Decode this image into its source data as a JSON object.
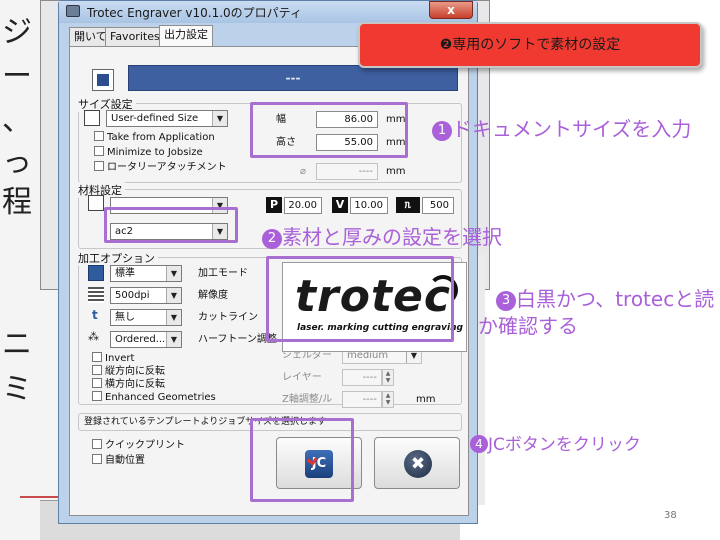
{
  "window": {
    "title": "Trotec Engraver v10.1.0のプロパティ",
    "close_label": "x"
  },
  "tabs": [
    {
      "label": "開いて"
    },
    {
      "label": "Favorites"
    },
    {
      "label": "出力設定"
    }
  ],
  "job_bar": {
    "text": "---"
  },
  "size_settings": {
    "group_label": "サイズ設定",
    "preset_value": "User-defined Size",
    "take_from_app": "Take from Application",
    "minimize": "Minimize to Jobsize",
    "rotary": "ロータリーアタッチメント",
    "width_label": "幅",
    "width_value": "86.00",
    "height_label": "高さ",
    "height_value": "55.00",
    "unit": "mm",
    "diameter_symbol": "⌀",
    "diameter_value": "----",
    "diameter_unit": "mm"
  },
  "material_settings": {
    "group_label": "材料設定",
    "material_value": "ac2",
    "power_badge": "P",
    "power_value": "20.00",
    "velocity_badge": "V",
    "velocity_value": "10.00",
    "ppi_value": "500"
  },
  "process_options": {
    "group_label": "加工オプション",
    "mode_value": "標準",
    "mode_label": "加工モード",
    "resolution_value": "500dpi",
    "resolution_label": "解像度",
    "cutline_value": "無し",
    "cutline_label": "カットライン",
    "halftone_value": "Ordered...",
    "halftone_label": "ハーフトーン調整",
    "invert": "Invert",
    "mirror_v": "縦方向に反転",
    "mirror_h": "横方向に反転",
    "enhanced": "Enhanced Geometries",
    "shader_label": "シェルダー",
    "shader_value": "medium",
    "layer_label": "レイヤー",
    "layer_value": "----",
    "z_label": "Z軸調整/ル",
    "z_value": "----",
    "z_unit": "mm"
  },
  "logo": {
    "name": "trotec",
    "tagline": "laser. marking cutting engraving"
  },
  "template_row": {
    "label": "登録されているテンプレートよりジョブサイズを選択します"
  },
  "bottom_options": {
    "quick_print": "クイックプリント",
    "auto_position": "自動位置"
  },
  "buttons": {
    "jc_label": "JC",
    "cancel_label": "✖"
  },
  "annotations": {
    "callout_num": "❷",
    "callout_text": "専用のソフトで素材の設定",
    "step1_num": "1",
    "step1_text": "ドキュメントサイズを入力",
    "step2_num": "2",
    "step2_text": "素材と厚みの設定を選択",
    "step3_num": "3",
    "step3_text_line1": "白黒かつ、trotecと読",
    "step3_text_line2": "か確認する",
    "step4_num": "4",
    "step4_text": "JCボタンをクリック"
  },
  "page_number": "38",
  "colors": {
    "highlight": "#a86fd0",
    "annotation_text": "#a960d8",
    "callout_bg": "#f03a31",
    "job_bar": "#3e5fa0"
  }
}
